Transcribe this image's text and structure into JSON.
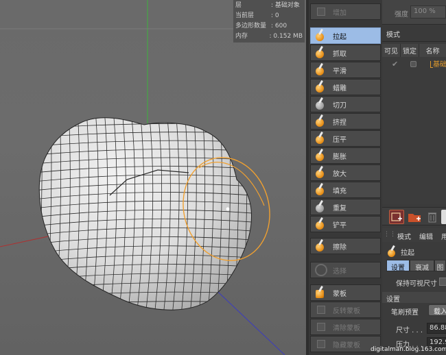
{
  "info": {
    "rows": [
      {
        "key": "层",
        "value": ": 基础对象"
      },
      {
        "key": "当前层",
        "value": ": 0"
      },
      {
        "key": "多边形数量",
        "value": ": 600"
      },
      {
        "key": "内存",
        "value": ": 0.152 MB"
      }
    ]
  },
  "tools": {
    "items": [
      {
        "label": "增加",
        "state": "disabled",
        "icon": "grid-icon"
      },
      {
        "label": "拉起",
        "state": "active",
        "icon": "pull-brush-icon"
      },
      {
        "label": "抓取",
        "state": "normal",
        "icon": "grab-brush-icon"
      },
      {
        "label": "平滑",
        "state": "normal",
        "icon": "smooth-brush-icon"
      },
      {
        "label": "蜡雕",
        "state": "normal",
        "icon": "wax-brush-icon"
      },
      {
        "label": "切刀",
        "state": "normal",
        "icon": "knife-brush-icon"
      },
      {
        "label": "挤捏",
        "state": "normal",
        "icon": "pinch-brush-icon"
      },
      {
        "label": "压平",
        "state": "normal",
        "icon": "flatten-brush-icon"
      },
      {
        "label": "膨胀",
        "state": "normal",
        "icon": "inflate-brush-icon"
      },
      {
        "label": "放大",
        "state": "normal",
        "icon": "magnify-brush-icon"
      },
      {
        "label": "填充",
        "state": "normal",
        "icon": "fill-brush-icon"
      },
      {
        "label": "重复",
        "state": "normal",
        "icon": "repeat-brush-icon"
      },
      {
        "label": "铲平",
        "state": "normal",
        "icon": "scrape-brush-icon"
      },
      {
        "label": "擦除",
        "state": "normal",
        "icon": "erase-brush-icon"
      },
      {
        "label": "选择",
        "state": "disabled",
        "icon": "select-brush-icon"
      },
      {
        "label": "蒙板",
        "state": "normal",
        "icon": "mask-brush-icon"
      },
      {
        "label": "反转蒙板",
        "state": "disabled",
        "icon": "invert-mask-icon"
      },
      {
        "label": "清除蒙板",
        "state": "disabled",
        "icon": "clear-mask-icon"
      },
      {
        "label": "隐藏蒙板",
        "state": "disabled",
        "icon": "hide-mask-icon"
      }
    ]
  },
  "panel": {
    "strength_label": "强度",
    "strength_value": "100 %",
    "mode_label": "模式",
    "layer_columns": [
      "可见",
      "锁定",
      "名称"
    ],
    "layer_check": "✔",
    "layer_name": "基础",
    "attr_menu": [
      "模式",
      "编辑",
      "用"
    ],
    "attr_title": "拉起",
    "attr_tabs": [
      "设置",
      "衰减",
      "图"
    ],
    "keep_visible_label": "保持可视尺寸",
    "settings_label": "设置",
    "preset_label": "笔刷预置",
    "preset_button": "载入",
    "size_label": "尺寸 . . .",
    "size_value": "86.88",
    "pressure_label": "压力 . . .",
    "pressure_value": "192.9"
  },
  "watermark": "digitalman.blog.163.com",
  "colors": {
    "accent": "#9cbce6",
    "brush_ring": "#f0a030",
    "layer_name": "#e09a2c"
  }
}
